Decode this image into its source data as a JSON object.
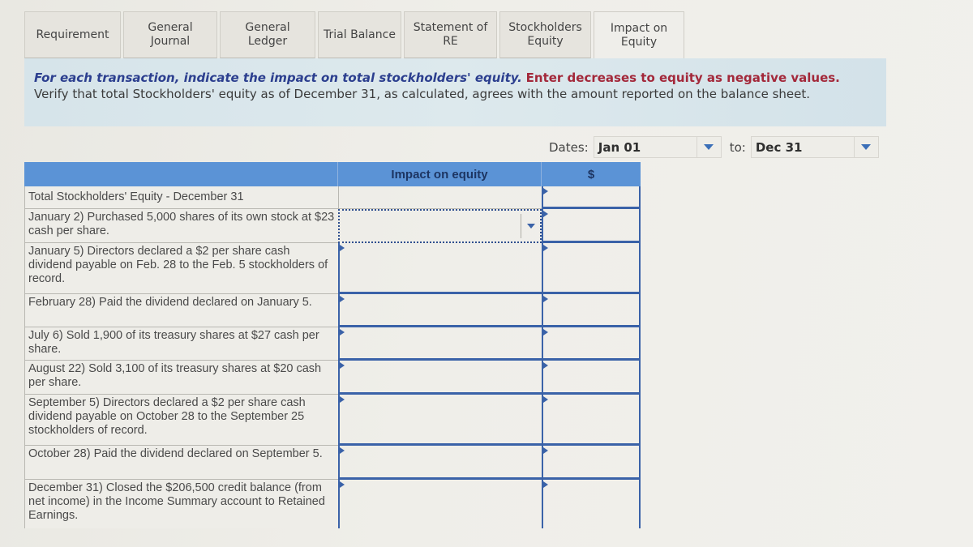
{
  "tabs": [
    {
      "label": "Requirement",
      "active": false
    },
    {
      "label": "General\nJournal",
      "active": false
    },
    {
      "label": "General\nLedger",
      "active": false
    },
    {
      "label": "Trial Balance",
      "active": false
    },
    {
      "label": "Statement of\nRE",
      "active": false
    },
    {
      "label": "Stockholders\nEquity",
      "active": false
    },
    {
      "label": "Impact on\nEquity",
      "active": true
    }
  ],
  "instructions": {
    "part1": "For each transaction, indicate the impact on total stockholders' equity.",
    "part2": "Enter decreases to equity as negative values.",
    "part3": "Verify that total Stockholders' equity as of December 31, as calculated, agrees with the amount reported on the balance sheet."
  },
  "dates": {
    "label": "Dates:",
    "from": "Jan 01",
    "to_label": "to:",
    "to": "Dec 31"
  },
  "table": {
    "headers": {
      "description": "",
      "impact": "Impact on equity",
      "amount": "$"
    },
    "rows": [
      {
        "description": "Total Stockholders' Equity - December 31",
        "impact": "",
        "amount": ""
      },
      {
        "description": "January 2)  Purchased 5,000 shares of its own stock at $23 cash per share.",
        "impact": "",
        "amount": ""
      },
      {
        "description": "January 5)  Directors declared a $2 per share cash dividend payable on Feb. 28 to the Feb. 5 stockholders of record.",
        "impact": "",
        "amount": ""
      },
      {
        "description": "February 28)  Paid the dividend declared on January 5.",
        "impact": "",
        "amount": ""
      },
      {
        "description": "July 6)  Sold 1,900 of its treasury shares at $27 cash per share.",
        "impact": "",
        "amount": ""
      },
      {
        "description": "August 22)  Sold 3,100 of its treasury shares at $20 cash per share.",
        "impact": "",
        "amount": ""
      },
      {
        "description": "September 5)  Directors declared a $2 per share cash dividend payable on October 28 to the September 25 stockholders of record.",
        "impact": "",
        "amount": ""
      },
      {
        "description": "October 28)  Paid the dividend declared on September 5.",
        "impact": "",
        "amount": ""
      },
      {
        "description": "December 31)  Closed the $206,500 credit balance (from net income) in the Income Summary account to Retained Earnings.",
        "impact": "",
        "amount": ""
      }
    ]
  },
  "colors": {
    "header_blue": "#5b93d6",
    "input_border_blue": "#3a62a8",
    "instruction_blue": "#2c3f8f",
    "instruction_red": "#a3283a",
    "panel_bg": "#d6e4ea"
  }
}
